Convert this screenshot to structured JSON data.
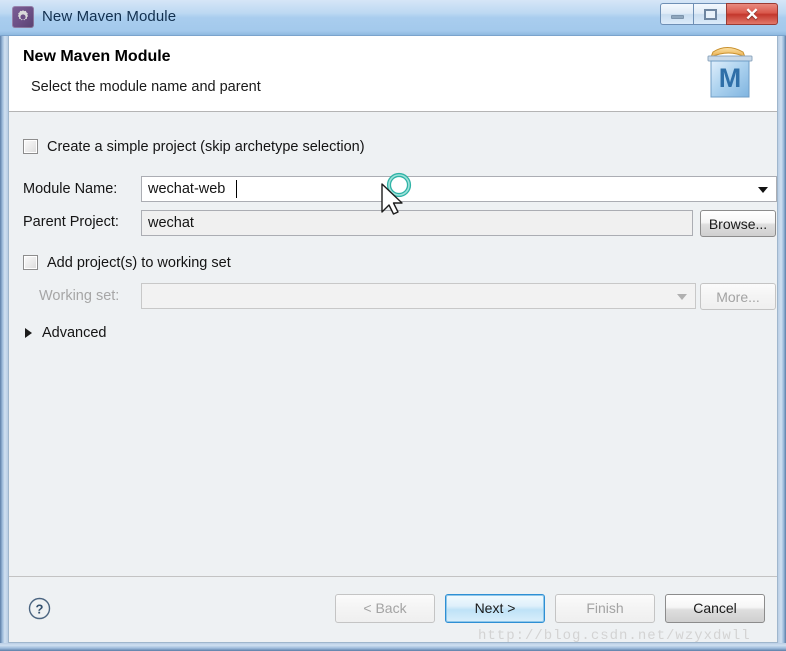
{
  "window": {
    "title": "New Maven Module",
    "icon": "maven-gear-icon",
    "controls": {
      "minimize": "minimize-icon",
      "maximize": "restore-icon",
      "close": "✕"
    }
  },
  "banner": {
    "title": "New Maven Module",
    "subtitle": "Select the module name and parent",
    "icon": "maven-module-icon"
  },
  "form": {
    "simple_project": {
      "label": "Create a simple project (skip archetype selection)",
      "checked": false
    },
    "module_name": {
      "label": "Module Name:",
      "value": "wechat-web",
      "placeholder": ""
    },
    "parent_project": {
      "label": "Parent Project:",
      "value": "wechat",
      "placeholder": "",
      "browse_label": "Browse..."
    },
    "working_set": {
      "add_label": "Add project(s) to working set",
      "checked": false,
      "label": "Working set:",
      "value": "",
      "more_label": "More...",
      "enabled": false
    },
    "advanced": {
      "label": "Advanced",
      "expanded": false
    }
  },
  "footer": {
    "help": "?",
    "back": "< Back",
    "next": "Next >",
    "finish": "Finish",
    "cancel": "Cancel"
  },
  "watermark": {
    "text": "http://blog.csdn.net/wzyxdwll"
  },
  "colors": {
    "titlebar": "#a9cdee",
    "close_button": "#c3372c",
    "default_button_border": "#2e8fd4",
    "body": "#eef1f3",
    "spinner": "#3fb8ae"
  }
}
